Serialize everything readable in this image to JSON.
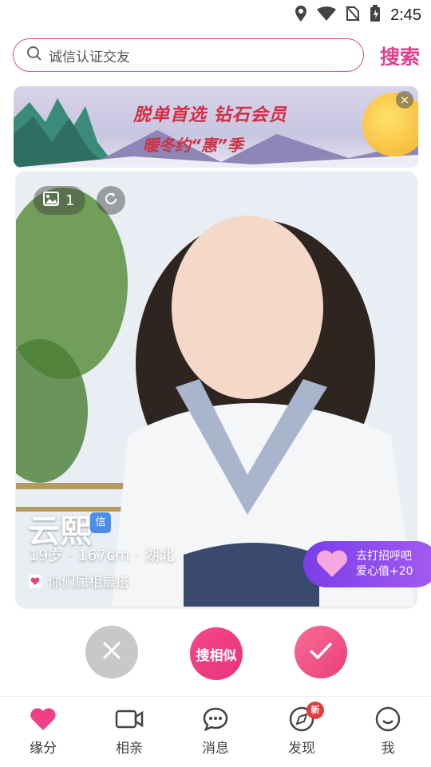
{
  "status_bar": {
    "time": "2:45"
  },
  "search": {
    "placeholder": "诚信认证交友",
    "button_label": "搜索"
  },
  "banner": {
    "line1": "脱单首选 钻石会员",
    "line2": "暖冬约“惠”季"
  },
  "profile": {
    "photo_count": "1",
    "name": "云熙",
    "badge": "信",
    "info": "19岁 · 167cm · 湖北",
    "zodiac_match": "你们属相最搭"
  },
  "greet": {
    "line1": "去打招呼吧",
    "line2": "爱心值+20"
  },
  "actions": {
    "similar_label": "搜相似"
  },
  "tabs": [
    {
      "label": "缘分"
    },
    {
      "label": "相亲"
    },
    {
      "label": "消息"
    },
    {
      "label": "发现",
      "badge": "新"
    },
    {
      "label": "我"
    }
  ],
  "colors": {
    "accent": "#e13f8f",
    "like": "#ea3f77",
    "greet": "#8b47ea"
  }
}
